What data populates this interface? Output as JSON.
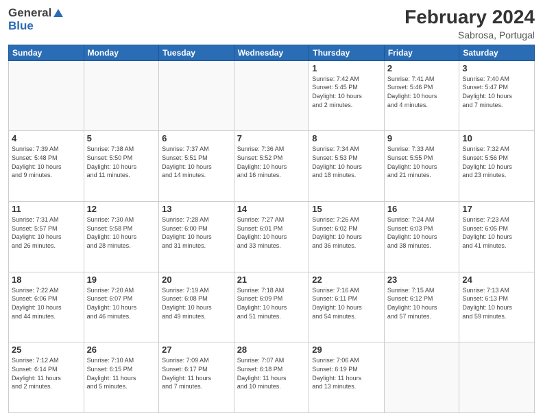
{
  "header": {
    "title": "February 2024",
    "subtitle": "Sabrosa, Portugal",
    "logo_general": "General",
    "logo_blue": "Blue"
  },
  "days_of_week": [
    "Sunday",
    "Monday",
    "Tuesday",
    "Wednesday",
    "Thursday",
    "Friday",
    "Saturday"
  ],
  "weeks": [
    [
      {
        "day": "",
        "info": ""
      },
      {
        "day": "",
        "info": ""
      },
      {
        "day": "",
        "info": ""
      },
      {
        "day": "",
        "info": ""
      },
      {
        "day": "1",
        "info": "Sunrise: 7:42 AM\nSunset: 5:45 PM\nDaylight: 10 hours\nand 2 minutes."
      },
      {
        "day": "2",
        "info": "Sunrise: 7:41 AM\nSunset: 5:46 PM\nDaylight: 10 hours\nand 4 minutes."
      },
      {
        "day": "3",
        "info": "Sunrise: 7:40 AM\nSunset: 5:47 PM\nDaylight: 10 hours\nand 7 minutes."
      }
    ],
    [
      {
        "day": "4",
        "info": "Sunrise: 7:39 AM\nSunset: 5:48 PM\nDaylight: 10 hours\nand 9 minutes."
      },
      {
        "day": "5",
        "info": "Sunrise: 7:38 AM\nSunset: 5:50 PM\nDaylight: 10 hours\nand 11 minutes."
      },
      {
        "day": "6",
        "info": "Sunrise: 7:37 AM\nSunset: 5:51 PM\nDaylight: 10 hours\nand 14 minutes."
      },
      {
        "day": "7",
        "info": "Sunrise: 7:36 AM\nSunset: 5:52 PM\nDaylight: 10 hours\nand 16 minutes."
      },
      {
        "day": "8",
        "info": "Sunrise: 7:34 AM\nSunset: 5:53 PM\nDaylight: 10 hours\nand 18 minutes."
      },
      {
        "day": "9",
        "info": "Sunrise: 7:33 AM\nSunset: 5:55 PM\nDaylight: 10 hours\nand 21 minutes."
      },
      {
        "day": "10",
        "info": "Sunrise: 7:32 AM\nSunset: 5:56 PM\nDaylight: 10 hours\nand 23 minutes."
      }
    ],
    [
      {
        "day": "11",
        "info": "Sunrise: 7:31 AM\nSunset: 5:57 PM\nDaylight: 10 hours\nand 26 minutes."
      },
      {
        "day": "12",
        "info": "Sunrise: 7:30 AM\nSunset: 5:58 PM\nDaylight: 10 hours\nand 28 minutes."
      },
      {
        "day": "13",
        "info": "Sunrise: 7:28 AM\nSunset: 6:00 PM\nDaylight: 10 hours\nand 31 minutes."
      },
      {
        "day": "14",
        "info": "Sunrise: 7:27 AM\nSunset: 6:01 PM\nDaylight: 10 hours\nand 33 minutes."
      },
      {
        "day": "15",
        "info": "Sunrise: 7:26 AM\nSunset: 6:02 PM\nDaylight: 10 hours\nand 36 minutes."
      },
      {
        "day": "16",
        "info": "Sunrise: 7:24 AM\nSunset: 6:03 PM\nDaylight: 10 hours\nand 38 minutes."
      },
      {
        "day": "17",
        "info": "Sunrise: 7:23 AM\nSunset: 6:05 PM\nDaylight: 10 hours\nand 41 minutes."
      }
    ],
    [
      {
        "day": "18",
        "info": "Sunrise: 7:22 AM\nSunset: 6:06 PM\nDaylight: 10 hours\nand 44 minutes."
      },
      {
        "day": "19",
        "info": "Sunrise: 7:20 AM\nSunset: 6:07 PM\nDaylight: 10 hours\nand 46 minutes."
      },
      {
        "day": "20",
        "info": "Sunrise: 7:19 AM\nSunset: 6:08 PM\nDaylight: 10 hours\nand 49 minutes."
      },
      {
        "day": "21",
        "info": "Sunrise: 7:18 AM\nSunset: 6:09 PM\nDaylight: 10 hours\nand 51 minutes."
      },
      {
        "day": "22",
        "info": "Sunrise: 7:16 AM\nSunset: 6:11 PM\nDaylight: 10 hours\nand 54 minutes."
      },
      {
        "day": "23",
        "info": "Sunrise: 7:15 AM\nSunset: 6:12 PM\nDaylight: 10 hours\nand 57 minutes."
      },
      {
        "day": "24",
        "info": "Sunrise: 7:13 AM\nSunset: 6:13 PM\nDaylight: 10 hours\nand 59 minutes."
      }
    ],
    [
      {
        "day": "25",
        "info": "Sunrise: 7:12 AM\nSunset: 6:14 PM\nDaylight: 11 hours\nand 2 minutes."
      },
      {
        "day": "26",
        "info": "Sunrise: 7:10 AM\nSunset: 6:15 PM\nDaylight: 11 hours\nand 5 minutes."
      },
      {
        "day": "27",
        "info": "Sunrise: 7:09 AM\nSunset: 6:17 PM\nDaylight: 11 hours\nand 7 minutes."
      },
      {
        "day": "28",
        "info": "Sunrise: 7:07 AM\nSunset: 6:18 PM\nDaylight: 11 hours\nand 10 minutes."
      },
      {
        "day": "29",
        "info": "Sunrise: 7:06 AM\nSunset: 6:19 PM\nDaylight: 11 hours\nand 13 minutes."
      },
      {
        "day": "",
        "info": ""
      },
      {
        "day": "",
        "info": ""
      }
    ]
  ]
}
